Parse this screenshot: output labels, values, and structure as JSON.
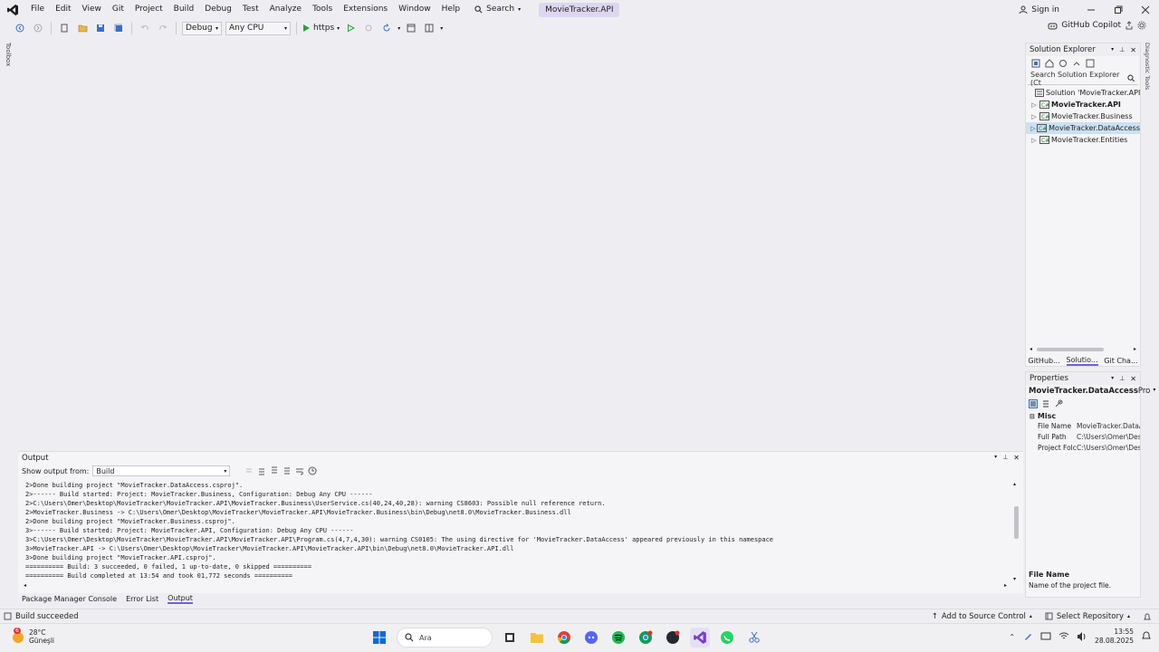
{
  "menu": {
    "items": [
      "File",
      "Edit",
      "View",
      "Git",
      "Project",
      "Build",
      "Debug",
      "Test",
      "Analyze",
      "Tools",
      "Extensions",
      "Window",
      "Help"
    ],
    "search_label": "Search",
    "project_name": "MovieTracker.API"
  },
  "titlebar": {
    "signin": "Sign in"
  },
  "toolbar": {
    "configuration": "Debug",
    "platform": "Any CPU",
    "run_profile": "https",
    "copilot": "GitHub Copilot"
  },
  "leftstrip": {
    "toolbox": "Toolbox"
  },
  "solution_explorer": {
    "title": "Solution Explorer",
    "search_placeholder": "Search Solution Explorer (Ct",
    "solution": "Solution 'MovieTracker.API' (",
    "projects": [
      {
        "name": "MovieTracker.API",
        "bold": true,
        "selected": false
      },
      {
        "name": "MovieTracker.Business",
        "bold": false,
        "selected": false
      },
      {
        "name": "MovieTracker.DataAccess",
        "bold": false,
        "selected": true
      },
      {
        "name": "MovieTracker.Entities",
        "bold": false,
        "selected": false
      }
    ]
  },
  "pane_tabs": [
    "GitHub...",
    "Solutio...",
    "Git Cha..."
  ],
  "pane_tabs_active": 1,
  "properties": {
    "title": "Properties",
    "object": "MovieTracker.DataAccess",
    "object_kind": "Pro",
    "category": "Misc",
    "rows": [
      {
        "key": "File Name",
        "value": "MovieTracker.DataA"
      },
      {
        "key": "Full Path",
        "value": "C:\\Users\\Omer\\Des"
      },
      {
        "key": "Project Folc",
        "value": "C:\\Users\\Omer\\Des"
      }
    ],
    "desc_title": "File Name",
    "desc_text": "Name of the project file."
  },
  "output": {
    "title": "Output",
    "show_from_label": "Show output from:",
    "show_from_value": "Build",
    "lines": [
      "2>Done building project \"MovieTracker.DataAccess.csproj\".",
      "2>------ Build started: Project: MovieTracker.Business, Configuration: Debug Any CPU ------",
      "2>C:\\Users\\Omer\\Desktop\\MovieTracker\\MovieTracker.API\\MovieTracker.Business\\UserService.cs(40,24,40,28): warning CS8603: Possible null reference return.",
      "2>MovieTracker.Business -> C:\\Users\\Omer\\Desktop\\MovieTracker\\MovieTracker.API\\MovieTracker.Business\\bin\\Debug\\net8.0\\MovieTracker.Business.dll",
      "2>Done building project \"MovieTracker.Business.csproj\".",
      "3>------ Build started: Project: MovieTracker.API, Configuration: Debug Any CPU ------",
      "3>C:\\Users\\Omer\\Desktop\\MovieTracker\\MovieTracker.API\\MovieTracker.API\\Program.cs(4,7,4,30): warning CS0105: The using directive for 'MovieTracker.DataAccess' appeared previously in this namespace",
      "3>MovieTracker.API -> C:\\Users\\Omer\\Desktop\\MovieTracker\\MovieTracker.API\\MovieTracker.API\\bin\\Debug\\net8.0\\MovieTracker.API.dll",
      "3>Done building project \"MovieTracker.API.csproj\".",
      "========== Build: 3 succeeded, 0 failed, 1 up-to-date, 0 skipped ==========",
      "========== Build completed at 13:54 and took 01,772 seconds =========="
    ]
  },
  "bottom_tabs": [
    "Package Manager Console",
    "Error List",
    "Output"
  ],
  "bottom_tabs_active": 2,
  "status": {
    "left": "Build succeeded",
    "add_source": "Add to Source Control",
    "select_repo": "Select Repository"
  },
  "taskbar": {
    "weather_temp": "28°C",
    "weather_desc": "Güneşli",
    "weather_badge": "6",
    "search_placeholder": "Ara",
    "time": "13:55",
    "date": "28.08.2025"
  },
  "colors": {
    "accent": "#7160e8",
    "selection": "#cce0f5",
    "background": "#eeeef2"
  }
}
